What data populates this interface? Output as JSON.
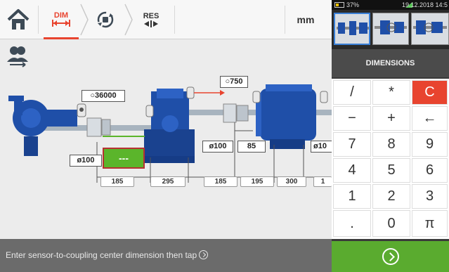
{
  "toolbar": {
    "dim_label": "DIM",
    "res_label": "RES",
    "unit": "mm"
  },
  "machine": {
    "rpm_label": "○36000",
    "distance_label": "○750",
    "coupling_left_diameter": "ø100",
    "coupling_mid_diameter": "ø100",
    "coupling_right_diameter": "ø10",
    "coupling_gap": "85",
    "active_field_value": "---",
    "dimensions": [
      "185",
      "295",
      "185",
      "195",
      "300",
      "1"
    ]
  },
  "hint": {
    "text": "Enter sensor-to-coupling center dimension then tap"
  },
  "status_bar": {
    "battery": "37%",
    "datetime": "19.12.2018 14:5"
  },
  "panel": {
    "title": "DIMENSIONS",
    "keys": [
      [
        "/",
        "*",
        "C"
      ],
      [
        "−",
        "+",
        "←"
      ],
      [
        "7",
        "8",
        "9"
      ],
      [
        "4",
        "5",
        "6"
      ],
      [
        "1",
        "2",
        "3"
      ],
      [
        ".",
        "0",
        "π"
      ]
    ]
  },
  "colors": {
    "accent_red": "#e8442f",
    "confirm_green": "#5aab2f",
    "machine_blue": "#1f4fa8"
  }
}
